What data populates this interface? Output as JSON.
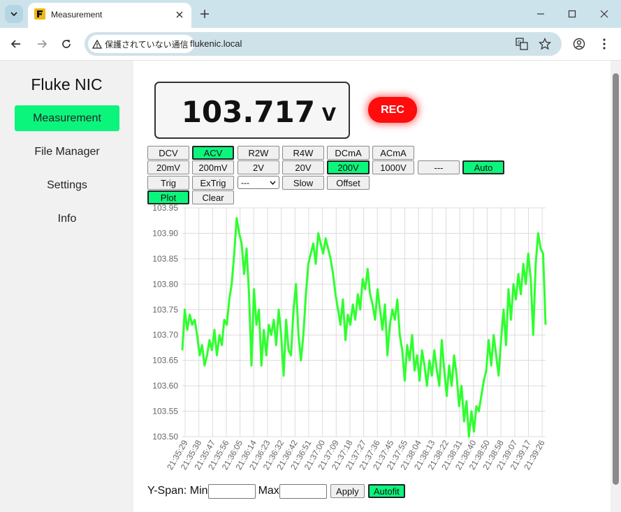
{
  "browser": {
    "tab_title": "Measurement",
    "security_label": "保護されていない通信",
    "url": "flukenic.local"
  },
  "sidebar": {
    "brand": "Fluke NIC",
    "items": [
      {
        "label": "Measurement",
        "active": true
      },
      {
        "label": "File Manager",
        "active": false
      },
      {
        "label": "Settings",
        "active": false
      },
      {
        "label": "Info",
        "active": false
      }
    ]
  },
  "readout": {
    "value": "103.717",
    "unit": "V"
  },
  "rec_label": "REC",
  "function_buttons": [
    "DCV",
    "ACV",
    "R2W",
    "R4W",
    "DCmA",
    "ACmA"
  ],
  "range_buttons": [
    "20mV",
    "200mV",
    "2V",
    "20V",
    "200V",
    "1000V",
    "---",
    "Auto"
  ],
  "trigger_row": {
    "trig": "Trig",
    "extrig": "ExTrig",
    "select_value": "---",
    "slow": "Slow",
    "offset": "Offset"
  },
  "plot_row": {
    "plot": "Plot",
    "clear": "Clear"
  },
  "active_buttons": [
    "ACV",
    "200V",
    "Auto",
    "Plot"
  ],
  "accent_color": "#0bf57d",
  "rec_color": "#ff0c0c",
  "yspan": {
    "label": "Y-Span: Min",
    "max_label": "Max",
    "min_value": "",
    "max_value": "",
    "apply": "Apply",
    "autofit": "Autofit"
  },
  "chart_data": {
    "type": "line",
    "title": "",
    "xlabel": "",
    "ylabel": "",
    "ylim": [
      103.5,
      103.95
    ],
    "grid": true,
    "line_color": "#2eff2e",
    "y_ticks": [
      "103.95",
      "103.90",
      "103.85",
      "103.80",
      "103.75",
      "103.70",
      "103.65",
      "103.60",
      "103.55",
      "103.50"
    ],
    "x_ticks": [
      "21:35:29",
      "21:35:38",
      "21:35:47",
      "21:35:56",
      "21:36:05",
      "21:36:14",
      "21:36:23",
      "21:36:32",
      "21:36:42",
      "21:36:51",
      "21:37:00",
      "21:37:09",
      "21:37:18",
      "21:37:27",
      "21:37:36",
      "21:37:45",
      "21:37:55",
      "21:38:04",
      "21:38:13",
      "21:38:22",
      "21:38:31",
      "21:38:40",
      "21:38:50",
      "21:38:58",
      "21:39:07",
      "21:39:17",
      "21:39:26"
    ],
    "series": [
      {
        "values": [
          103.67,
          103.75,
          103.71,
          103.74,
          103.72,
          103.73,
          103.7,
          103.66,
          103.68,
          103.64,
          103.66,
          103.69,
          103.67,
          103.71,
          103.66,
          103.7,
          103.68,
          103.73,
          103.72,
          103.77,
          103.8,
          103.86,
          103.93,
          103.9,
          103.88,
          103.82,
          103.87,
          103.78,
          103.64,
          103.79,
          103.72,
          103.75,
          103.64,
          103.71,
          103.66,
          103.72,
          103.7,
          103.73,
          103.68,
          103.75,
          103.7,
          103.62,
          103.73,
          103.67,
          103.66,
          103.75,
          103.8,
          103.7,
          103.65,
          103.7,
          103.78,
          103.84,
          103.86,
          103.88,
          103.84,
          103.9,
          103.88,
          103.86,
          103.89,
          103.87,
          103.85,
          103.82,
          103.78,
          103.75,
          103.72,
          103.77,
          103.69,
          103.74,
          103.72,
          103.76,
          103.73,
          103.78,
          103.75,
          103.81,
          103.79,
          103.83,
          103.78,
          103.76,
          103.73,
          103.79,
          103.75,
          103.71,
          103.76,
          103.66,
          103.72,
          103.75,
          103.73,
          103.77,
          103.7,
          103.67,
          103.61,
          103.68,
          103.65,
          103.7,
          103.63,
          103.66,
          103.61,
          103.67,
          103.64,
          103.6,
          103.65,
          103.62,
          103.67,
          103.63,
          103.6,
          103.69,
          103.63,
          103.58,
          103.64,
          103.6,
          103.66,
          103.62,
          103.56,
          103.6,
          103.53,
          103.57,
          103.5,
          103.55,
          103.51,
          103.56,
          103.55,
          103.58,
          103.61,
          103.63,
          103.69,
          103.64,
          103.7,
          103.66,
          103.62,
          103.69,
          103.75,
          103.68,
          103.79,
          103.73,
          103.8,
          103.77,
          103.82,
          103.78,
          103.84,
          103.8,
          103.86,
          103.81,
          103.7,
          103.84,
          103.9,
          103.87,
          103.86,
          103.72
        ]
      }
    ]
  }
}
